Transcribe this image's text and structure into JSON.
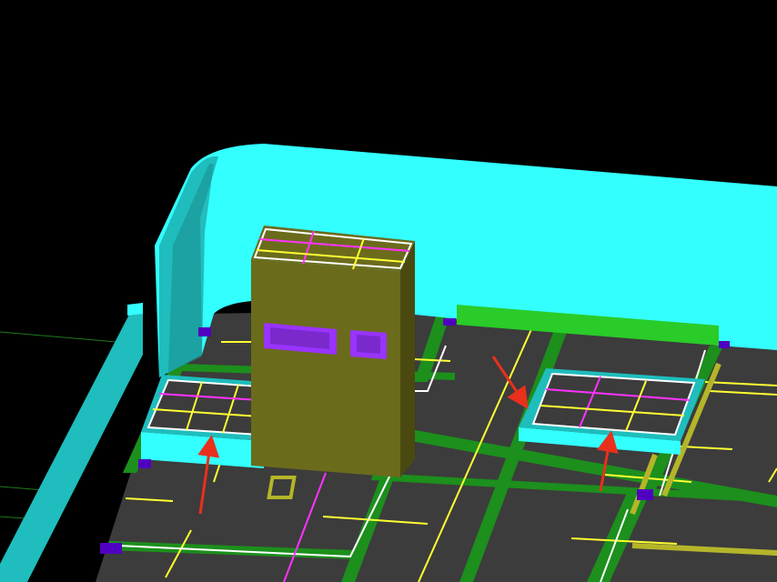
{
  "view": {
    "background": "#000000",
    "type": "3d-cad-model-viewport"
  },
  "colors": {
    "wall_top": "#33ffff",
    "wall_side": "#1fbdbd",
    "wall_dark": "#1a8f8f",
    "floor": "#3c3c3c",
    "beam": "#1c8f1c",
    "beam_bright": "#29cc29",
    "column": "#6b6b1c",
    "column_dark": "#4a4a10",
    "window": "#9933ff",
    "rebar_yellow": "#ffff33",
    "rebar_magenta": "#ff33ff",
    "rebar_white": "#ffffff",
    "arrow": "#e8301c",
    "connector": "#5000c0"
  },
  "annotations": [
    {
      "name": "arrow-left-opening",
      "target": "slab-opening-left"
    },
    {
      "name": "arrow-right-opening-down",
      "target": "slab-opening-right"
    },
    {
      "name": "arrow-right-opening-up",
      "target": "slab-opening-right"
    }
  ]
}
